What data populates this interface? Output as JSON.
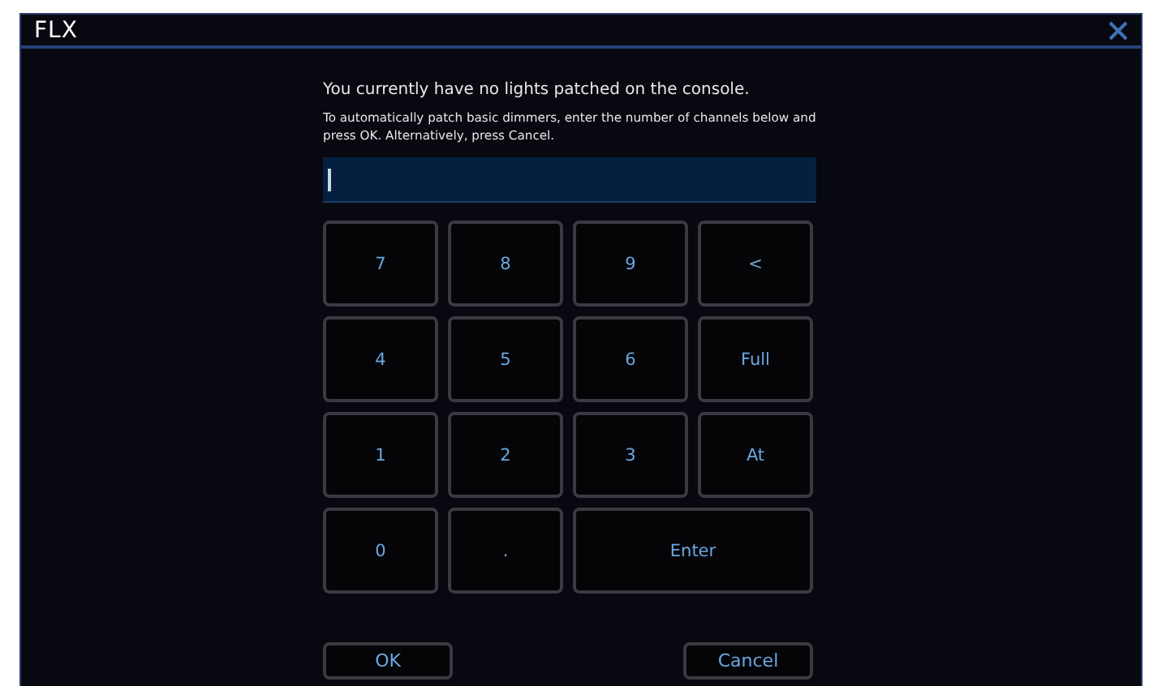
{
  "window": {
    "title": "FLX"
  },
  "message": "You currently have no lights patched on the console.",
  "instructions": "To automatically patch basic dimmers, enter the number of channels below and press OK. Alternatively, press Cancel.",
  "channel_field": {
    "focused": true
  },
  "keypad": [
    {
      "label": "7",
      "wide": false
    },
    {
      "label": "8",
      "wide": false
    },
    {
      "label": "9",
      "wide": false
    },
    {
      "label": "<",
      "wide": false
    },
    {
      "label": "4",
      "wide": false
    },
    {
      "label": "5",
      "wide": false
    },
    {
      "label": "6",
      "wide": false
    },
    {
      "label": "Full",
      "wide": false
    },
    {
      "label": "1",
      "wide": false
    },
    {
      "label": "2",
      "wide": false
    },
    {
      "label": "3",
      "wide": false
    },
    {
      "label": "At",
      "wide": false
    },
    {
      "label": "0",
      "wide": false
    },
    {
      "label": ".",
      "wide": false
    },
    {
      "label": "Enter",
      "wide": true
    }
  ],
  "buttons": [
    "OK",
    "Cancel"
  ]
}
